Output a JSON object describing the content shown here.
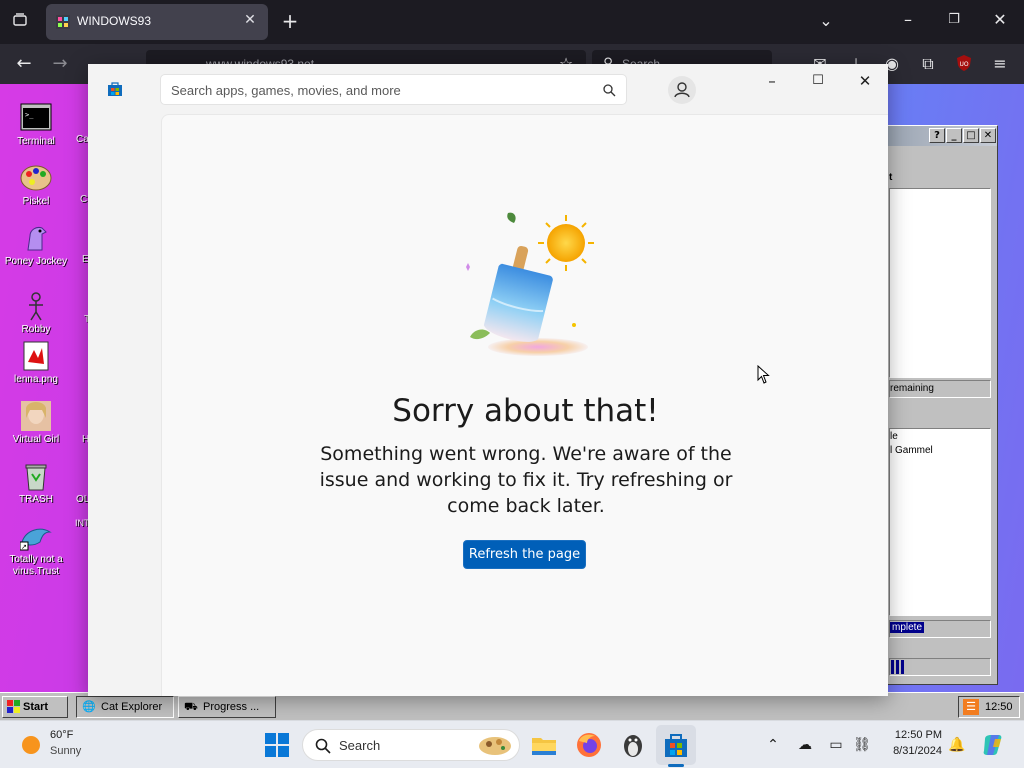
{
  "browser": {
    "tab_title": "WINDOWS93",
    "url": "www.windows93.net",
    "search_placeholder": "Search"
  },
  "desktop": {
    "icons": [
      {
        "label": "Terminal"
      },
      {
        "label": "Piskel"
      },
      {
        "label": "Poney Jockey"
      },
      {
        "label": "Robby"
      },
      {
        "label": "lenna.png"
      },
      {
        "label": "Virtual Girl"
      },
      {
        "label": "TRASH"
      },
      {
        "label": "Totally not a virus.Trust"
      }
    ],
    "side_fragments": [
      "Ca",
      "C",
      "E",
      "T",
      "H",
      "OL",
      "INT"
    ],
    "bg_window": {
      "frag_header": "t",
      "frag_remaining": "remaining",
      "frag_line1": "le",
      "frag_line2": "l Gammel",
      "frag_complete": "mplete"
    },
    "taskbar": {
      "start": "Start",
      "tasks": [
        "Cat Explorer",
        "Progress ..."
      ],
      "clock": "12:50"
    }
  },
  "store": {
    "search_placeholder": "Search apps, games, movies, and more",
    "error_title": "Sorry about that!",
    "error_message": "Something went wrong. We're aware of the issue and working to fix it. Try refreshing or come back later.",
    "refresh_label": "Refresh the page"
  },
  "taskbar": {
    "weather_temp": "60°F",
    "weather_condition": "Sunny",
    "search_label": "Search",
    "time": "12:50 PM",
    "date": "8/31/2024"
  }
}
